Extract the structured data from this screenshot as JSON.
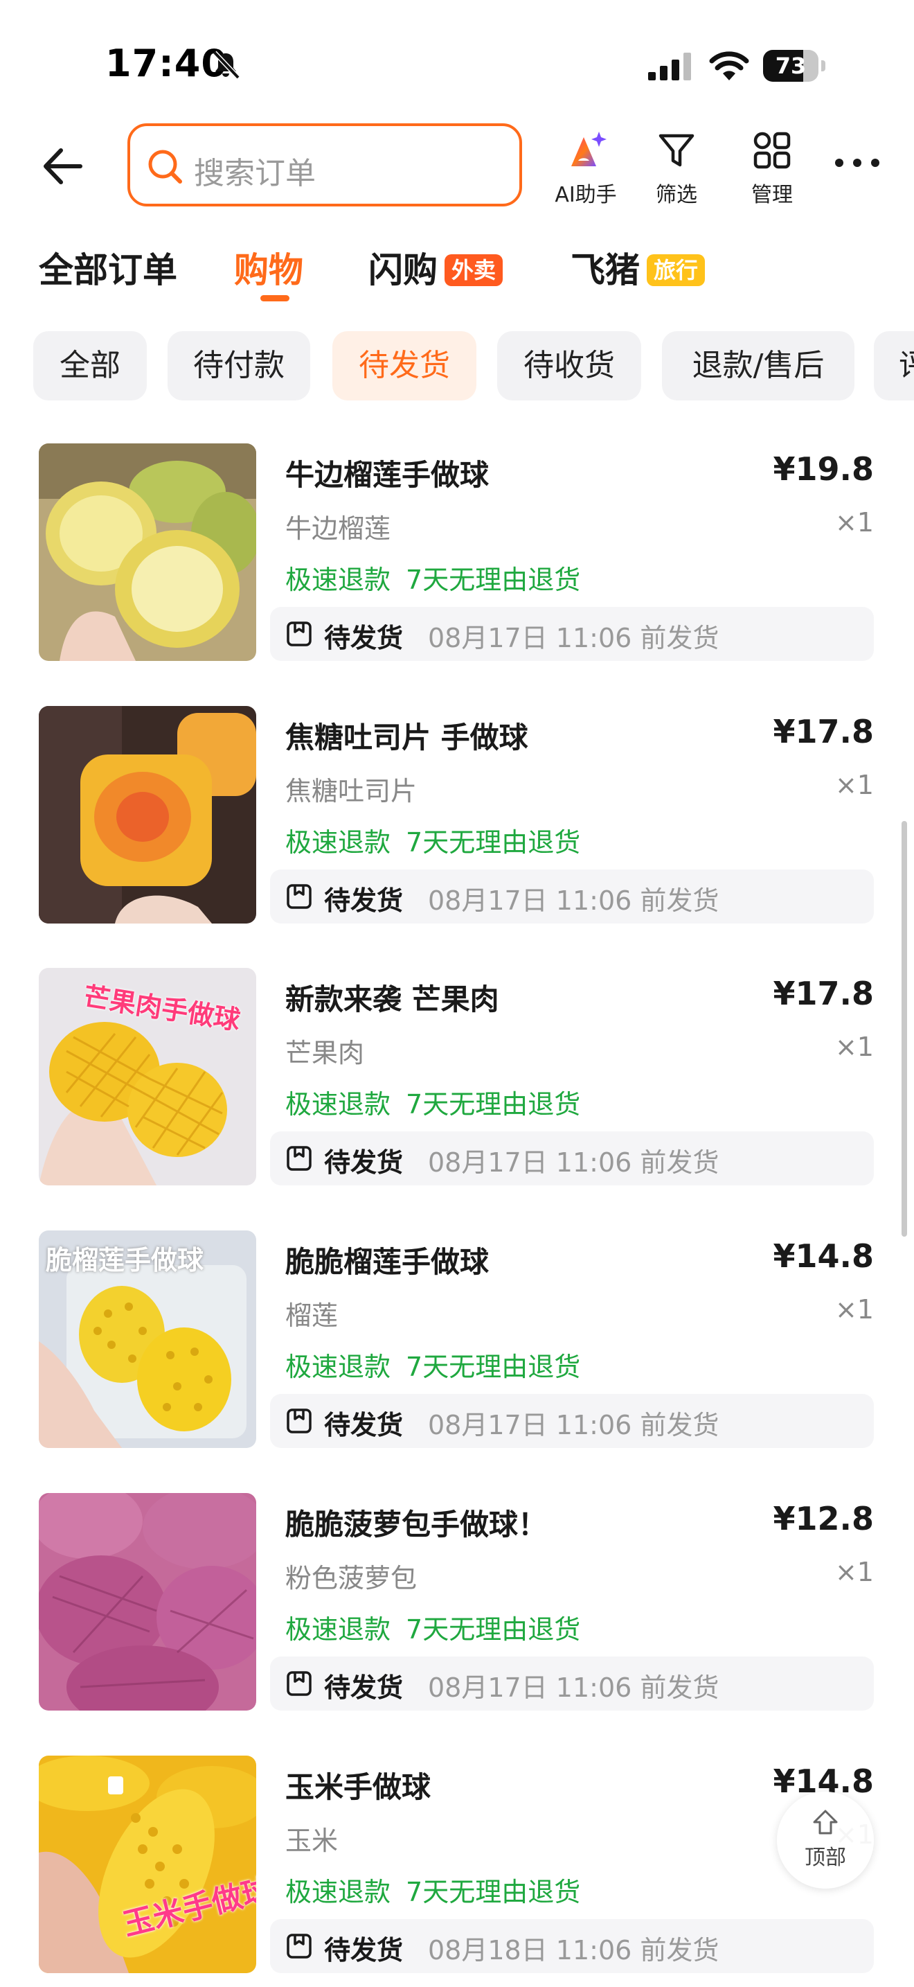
{
  "status_bar": {
    "time": "17:40",
    "battery": "73",
    "battery_level": 0.73
  },
  "search": {
    "placeholder": "搜索订单"
  },
  "toolbar": {
    "ai_label": "AI助手",
    "filter_label": "筛选",
    "manage_label": "管理"
  },
  "tabs": [
    {
      "label": "全部订单"
    },
    {
      "label": "购物"
    },
    {
      "label": "闪购",
      "badge": "外卖"
    },
    {
      "label": "飞猪",
      "badge": "旅行"
    }
  ],
  "active_tab": "购物",
  "chips": [
    "全部",
    "待付款",
    "待发货",
    "待收货",
    "退款/售后",
    "评"
  ],
  "active_chip": "待发货",
  "colors": {
    "accent": "#ff6a1a",
    "green_tag": "#1fa83f",
    "waimai_badge": "#ff5a1f",
    "lvxing_badge": "#ffc21a"
  },
  "orders": [
    {
      "title": "牛边榴莲手做球",
      "price": "¥19.8",
      "sku": "牛边榴莲",
      "qty": "×1",
      "tag1": "极速退款",
      "tag2": "7天无理由退货",
      "status": "待发货",
      "ship_time": "08月17日 11:06 前发货",
      "image": "durian-halves-photo"
    },
    {
      "title": "焦糖吐司片 手做球",
      "price": "¥17.8",
      "sku": "焦糖吐司片",
      "qty": "×1",
      "tag1": "极速退款",
      "tag2": "7天无理由退货",
      "status": "待发货",
      "ship_time": "08月17日 11:06 前发货",
      "image": "caramel-toast-photo"
    },
    {
      "title": "新款来袭 芒果肉",
      "price": "¥17.8",
      "sku": "芒果肉",
      "qty": "×1",
      "tag1": "极速退款",
      "tag2": "7天无理由退货",
      "status": "待发货",
      "ship_time": "08月17日 11:06 前发货",
      "image": "mango-photo",
      "image_text": "芒果肉手做球"
    },
    {
      "title": "脆脆榴莲手做球",
      "price": "¥14.8",
      "sku": "榴莲",
      "qty": "×1",
      "tag1": "极速退款",
      "tag2": "7天无理由退货",
      "status": "待发货",
      "ship_time": "08月17日 11:06 前发货",
      "image": "durian-ball-photo",
      "image_text": "脆榴莲手做球"
    },
    {
      "title": "脆脆菠萝包手做球！",
      "price": "¥12.8",
      "sku": "粉色菠萝包",
      "qty": "×1",
      "tag1": "极速退款",
      "tag2": "7天无理由退货",
      "status": "待发货",
      "ship_time": "08月17日 11:06 前发货",
      "image": "pink-pineapple-bun-photo"
    },
    {
      "title": "玉米手做球",
      "price": "¥14.8",
      "sku": "玉米",
      "qty": "×1",
      "tag1": "极速退款",
      "tag2": "7天无理由退货",
      "status": "待发货",
      "ship_time": "08月18日 11:06 前发货",
      "image": "corn-photo",
      "image_text": "玉米手做球"
    }
  ],
  "top_button": {
    "label": "顶部"
  }
}
